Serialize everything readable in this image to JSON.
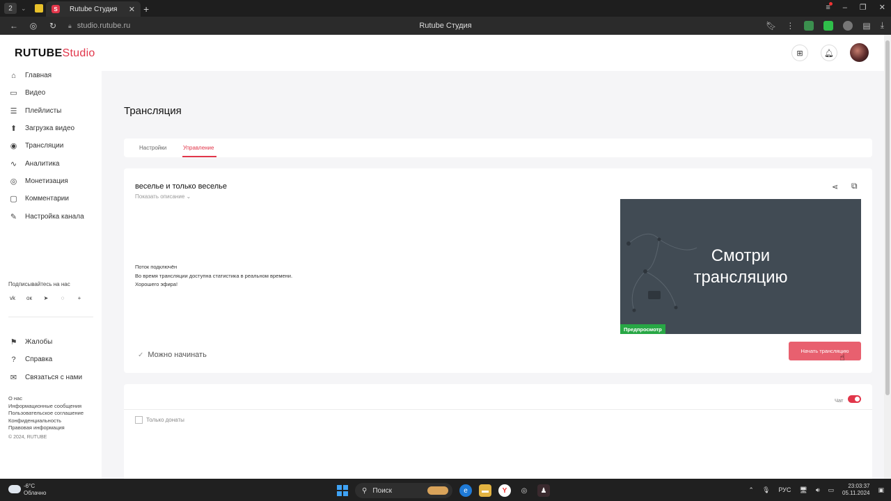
{
  "browser": {
    "tab_count": "2",
    "tab_title": "Rutube Студия",
    "url": "studio.rutube.ru",
    "page_title": "Rutube Студия"
  },
  "header": {
    "logo_rutube": "RUTUBE",
    "logo_studio": "Studio"
  },
  "sidebar": {
    "items": [
      {
        "label": "Главная",
        "icon": "home-icon"
      },
      {
        "label": "Видео",
        "icon": "video-icon"
      },
      {
        "label": "Плейлисты",
        "icon": "playlist-icon"
      },
      {
        "label": "Загрузка видео",
        "icon": "upload-icon"
      },
      {
        "label": "Трансляции",
        "icon": "broadcast-icon"
      },
      {
        "label": "Аналитика",
        "icon": "analytics-icon"
      },
      {
        "label": "Монетизация",
        "icon": "monetization-icon"
      },
      {
        "label": "Комментарии",
        "icon": "comments-icon"
      },
      {
        "label": "Настройка канала",
        "icon": "channel-settings-icon"
      }
    ],
    "subscribe_label": "Подписывайтесь на нас",
    "socials": [
      "vk",
      "ok",
      "telegram",
      "viber",
      "plus"
    ],
    "items2": [
      {
        "label": "Жалобы",
        "icon": "flag-icon"
      },
      {
        "label": "Справка",
        "icon": "help-icon"
      },
      {
        "label": "Связаться с нами",
        "icon": "contact-icon"
      }
    ],
    "footer_links": [
      "О нас",
      "Информационные сообщения",
      "Пользовательское соглашение",
      "Конфиденциальность",
      "Правовая информация"
    ],
    "copyright": "© 2024, RUTUBE"
  },
  "main": {
    "page_title": "Трансляция",
    "tabs": [
      {
        "label": "Настройки",
        "active": false
      },
      {
        "label": "Управление",
        "active": true
      }
    ],
    "stream": {
      "title": "веселье и только веселье",
      "show_description": "Показать описание",
      "status_title": "Поток подключён",
      "status_text": "Во время трансляции доступна статистика в реальном времени.",
      "status_wish": "Хорошего эфира!",
      "preview_line1": "Смотри",
      "preview_line2": "трансляцию",
      "preview_badge": "Предпросмотр",
      "ready_label": "Можно начинать",
      "start_button": "Начать трансляцию"
    },
    "chat": {
      "toggle_label": "Чат",
      "toggle_on": true,
      "donations_only": "Только донаты",
      "donations_checked": false
    }
  },
  "taskbar": {
    "temperature": "-6°C",
    "weather": "Облачно",
    "search": "Поиск",
    "lang": "РУС",
    "time": "23:03:37",
    "date": "05.11.2024"
  },
  "colors": {
    "accent": "#e1364a",
    "start_button": "#e8606f",
    "preview_bg": "#414b54",
    "badge_green": "#28a745",
    "fab": "#1a9b8c"
  }
}
